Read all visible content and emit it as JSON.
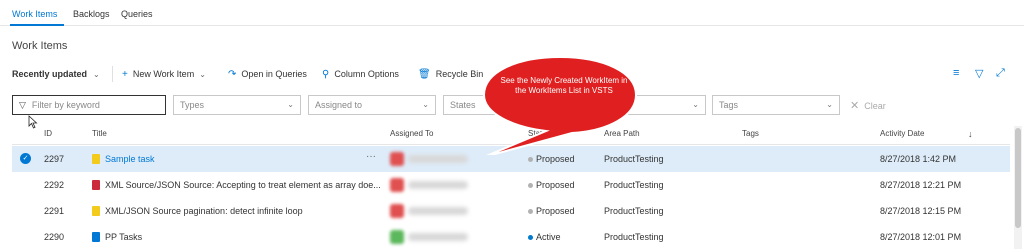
{
  "nav": {
    "tabs": [
      "Work Items",
      "Backlogs",
      "Queries"
    ],
    "active": "Work Items"
  },
  "page": {
    "title": "Work Items"
  },
  "toolbar": {
    "recently_updated": "Recently updated",
    "new_work_item": "New Work Item",
    "open_in_queries": "Open in Queries",
    "column_options": "Column Options",
    "recycle_bin": "Recycle Bin"
  },
  "filters": {
    "keyword_placeholder": "Filter by keyword",
    "types": "Types",
    "assigned_to": "Assigned to",
    "states": "States",
    "tags": "Tags",
    "clear": "Clear"
  },
  "columns": {
    "id": "ID",
    "title": "Title",
    "assigned_to": "Assigned To",
    "state": "State",
    "area_path": "Area Path",
    "tags": "Tags",
    "activity_date": "Activity Date"
  },
  "rows": [
    {
      "id": "2297",
      "title": "Sample task",
      "state": "Proposed",
      "area_path": "ProductTesting",
      "activity_date": "8/27/2018 1:42 PM",
      "type_color": "#f2cb1d",
      "state_color": "#b2b2b2",
      "avatar_color": "#e05050"
    },
    {
      "id": "2292",
      "title": "XML Source/JSON Source: Accepting to treat element as array doe...",
      "state": "Proposed",
      "area_path": "ProductTesting",
      "activity_date": "8/27/2018 12:21 PM",
      "type_color": "#cc293d",
      "state_color": "#b2b2b2",
      "avatar_color": "#e05050"
    },
    {
      "id": "2291",
      "title": "XML/JSON Source pagination: detect infinite loop",
      "state": "Proposed",
      "area_path": "ProductTesting",
      "activity_date": "8/27/2018 12:15 PM",
      "type_color": "#f2cb1d",
      "state_color": "#b2b2b2",
      "avatar_color": "#e05050"
    },
    {
      "id": "2290",
      "title": "PP Tasks",
      "state": "Active",
      "area_path": "ProductTesting",
      "activity_date": "8/27/2018 12:01 PM",
      "type_color": "#0078d4",
      "state_color": "#007acc",
      "avatar_color": "#5cb85c"
    }
  ],
  "callout": {
    "text": "See the Newly Created WorkItem in the WorkItems List in VSTS",
    "color": "#e02020"
  }
}
